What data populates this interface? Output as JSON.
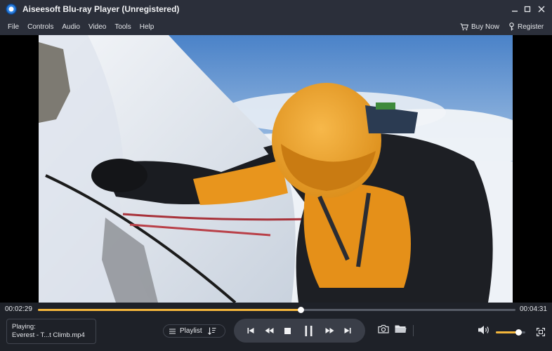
{
  "window": {
    "title": "Aiseesoft Blu-ray Player (Unregistered)",
    "minimize_glyph": "—",
    "maximize_glyph": "☐",
    "close_glyph": "✕"
  },
  "menu": {
    "items": [
      "File",
      "Controls",
      "Audio",
      "Video",
      "Tools",
      "Help"
    ],
    "buy_now": "Buy Now",
    "register": "Register"
  },
  "player": {
    "current_time": "00:02:29",
    "total_time": "00:04:31",
    "progress": 0.55,
    "volume": 0.75,
    "now_playing_label": "Playing:",
    "now_playing_file": "Everest - T...t Climb.mp4",
    "playlist_label": "Playlist"
  },
  "colors": {
    "accent": "#f4b63b",
    "bar_bg": "#2b2f3a",
    "control_bg": "#1e2128",
    "transport_bg": "#3a3e48"
  },
  "icons": {
    "app": "blu-ray-disc-icon",
    "buy": "cart-icon",
    "register": "key-icon",
    "playlist": "list-icon",
    "sort": "sort-icon",
    "transport": [
      "skip-previous-icon",
      "rewind-icon",
      "stop-icon",
      "pause-icon",
      "fast-forward-icon",
      "skip-next-icon"
    ],
    "snapshot": "camera-icon",
    "open": "folder-icon",
    "volume": "speaker-icon",
    "fullscreen": "fullscreen-icon"
  }
}
